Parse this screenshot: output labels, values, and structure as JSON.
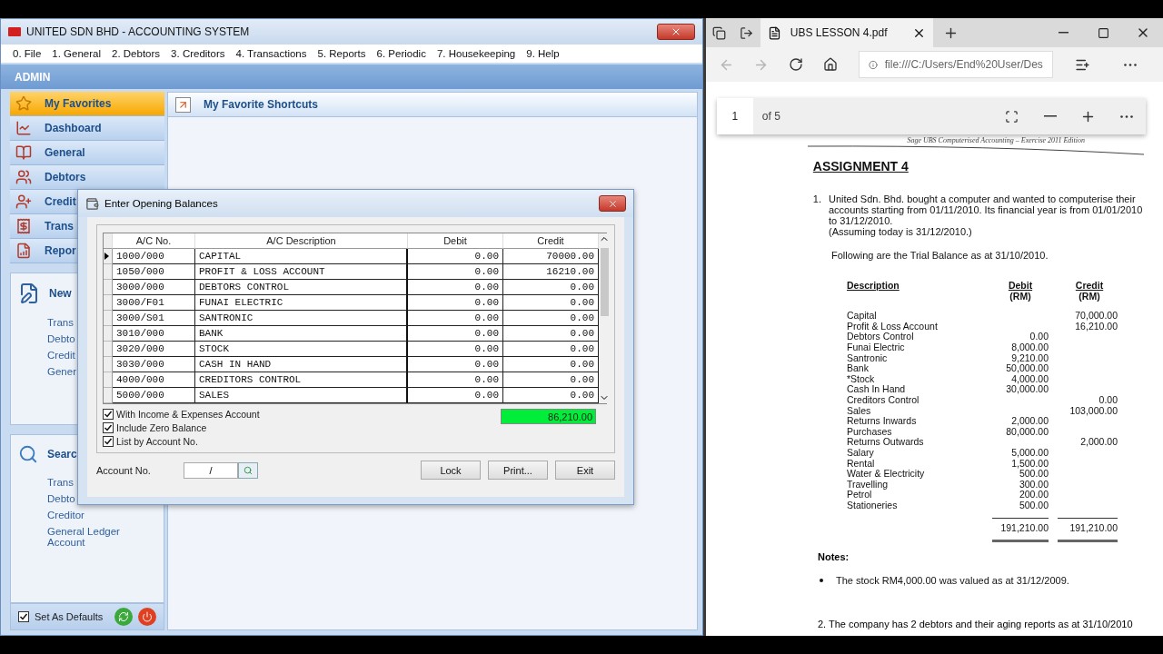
{
  "app": {
    "title": "UNITED SDN BHD - ACCOUNTING SYSTEM",
    "menu": [
      "0. File",
      "1. General",
      "2. Debtors",
      "3. Creditors",
      "4. Transactions",
      "5. Reports",
      "6. Periodic",
      "7. Housekeeping",
      "9. Help"
    ],
    "user": "ADMIN",
    "sidebar": {
      "nav": [
        {
          "label": "My Favorites",
          "selected": true
        },
        {
          "label": "Dashboard",
          "selected": false
        },
        {
          "label": "General",
          "selected": false
        },
        {
          "label": "Debtors",
          "selected": false
        },
        {
          "label": "Credit",
          "selected": false
        },
        {
          "label": "Trans",
          "selected": false
        },
        {
          "label": "Repor",
          "selected": false
        }
      ],
      "new_section": {
        "title": "New",
        "links": [
          "Trans",
          "Debto",
          "Credit",
          "Gener"
        ]
      },
      "search_section": {
        "title": "Searc",
        "links": [
          "Trans",
          "Debto",
          "Creditor",
          "General Ledger Account"
        ]
      },
      "set_as_defaults": {
        "label": "Set As Defaults",
        "checked": true
      }
    },
    "content_header": "My Favorite Shortcuts"
  },
  "dialog": {
    "title": "Enter Opening Balances",
    "columns": [
      "A/C No.",
      "A/C Description",
      "Debit",
      "Credit"
    ],
    "rows": [
      {
        "account": "1000/000",
        "description": "CAPITAL",
        "debit": "0.00",
        "credit": "70000.00",
        "selected": true
      },
      {
        "account": "1050/000",
        "description": "PROFIT & LOSS ACCOUNT",
        "debit": "0.00",
        "credit": "16210.00",
        "selected": false
      },
      {
        "account": "3000/000",
        "description": "DEBTORS CONTROL",
        "debit": "0.00",
        "credit": "0.00",
        "selected": false
      },
      {
        "account": "3000/F01",
        "description": "FUNAI ELECTRIC",
        "debit": "0.00",
        "credit": "0.00",
        "selected": false
      },
      {
        "account": "3000/S01",
        "description": "SANTRONIC",
        "debit": "0.00",
        "credit": "0.00",
        "selected": false
      },
      {
        "account": "3010/000",
        "description": "BANK",
        "debit": "0.00",
        "credit": "0.00",
        "selected": false
      },
      {
        "account": "3020/000",
        "description": "STOCK",
        "debit": "0.00",
        "credit": "0.00",
        "selected": false
      },
      {
        "account": "3030/000",
        "description": "CASH IN HAND",
        "debit": "0.00",
        "credit": "0.00",
        "selected": false
      },
      {
        "account": "4000/000",
        "description": "CREDITORS CONTROL",
        "debit": "0.00",
        "credit": "0.00",
        "selected": false
      },
      {
        "account": "5000/000",
        "description": "SALES",
        "debit": "0.00",
        "credit": "0.00",
        "selected": false
      }
    ],
    "options": [
      {
        "label": "With Income & Expenses Account",
        "checked": true
      },
      {
        "label": "Include Zero Balance",
        "checked": true
      },
      {
        "label": "List by Account No.",
        "checked": true
      }
    ],
    "total": "86,210.00",
    "account_label": "Account No.",
    "account_value": "/",
    "buttons": [
      "Lock",
      "Print...",
      "Exit"
    ]
  },
  "browser": {
    "tabs": [
      {
        "label": "UBS LESSON 4.pdf",
        "selected": true
      }
    ],
    "back_disabled": true,
    "forward_disabled": true,
    "url": "file:///C:/Users/End%20User/Des",
    "page": "1",
    "page_count": "of 5",
    "document": {
      "header": "Sage UBS Computerised Accounting – Exercise 2011 Edition",
      "title": "ASSIGNMENT 4",
      "item_number": "1.",
      "paragraph": "United Sdn. Bhd. bought a computer and wanted to computerise their accounts starting from 01/11/2010. Its financial year is from 01/01/2010 to 31/12/2010.",
      "assumption": "(Assuming today is 31/12/2010.)",
      "intro": "Following are the Trial Balance as at 31/10/2010.",
      "table_headers": {
        "description": "Description",
        "debit": "Debit",
        "debit_unit": "(RM)",
        "credit": "Credit",
        "credit_unit": "(RM)"
      },
      "rows": [
        {
          "description": "Capital",
          "credit": "70,000.00"
        },
        {
          "description": "Profit & Loss Account",
          "credit": "16,210.00"
        },
        {
          "description": "Debtors Control",
          "debit": "0.00"
        },
        {
          "description": "Funai Electric",
          "debit": "8,000.00"
        },
        {
          "description": "Santronic",
          "debit": "9,210.00"
        },
        {
          "description": "Bank",
          "debit": "50,000.00"
        },
        {
          "description": "*Stock",
          "debit": "4,000.00"
        },
        {
          "description": "Cash In Hand",
          "debit": "30,000.00"
        },
        {
          "description": "Creditors Control",
          "credit": "0.00"
        },
        {
          "description": "Sales",
          "credit": "103,000.00"
        },
        {
          "description": "Returns Inwards",
          "debit": "2,000.00"
        },
        {
          "description": "Purchases",
          "debit": "80,000.00"
        },
        {
          "description": "Returns Outwards",
          "credit": "2,000.00"
        },
        {
          "description": "Salary",
          "debit": "5,000.00"
        },
        {
          "description": "Rental",
          "debit": "1,500.00"
        },
        {
          "description": "Water & Electricity",
          "debit": "500.00"
        },
        {
          "description": "Travelling",
          "debit": "300.00"
        },
        {
          "description": "Petrol",
          "debit": "200.00"
        },
        {
          "description": "Stationeries",
          "debit": "500.00"
        }
      ],
      "total_debit": "191,210.00",
      "total_credit": "191,210.00",
      "notes_title": "Notes:",
      "notes": [
        "The stock RM4,000.00 was valued as at 31/12/2009."
      ],
      "next_item": "2.  The company has 2 debtors and their aging reports as at 31/10/2010"
    }
  }
}
